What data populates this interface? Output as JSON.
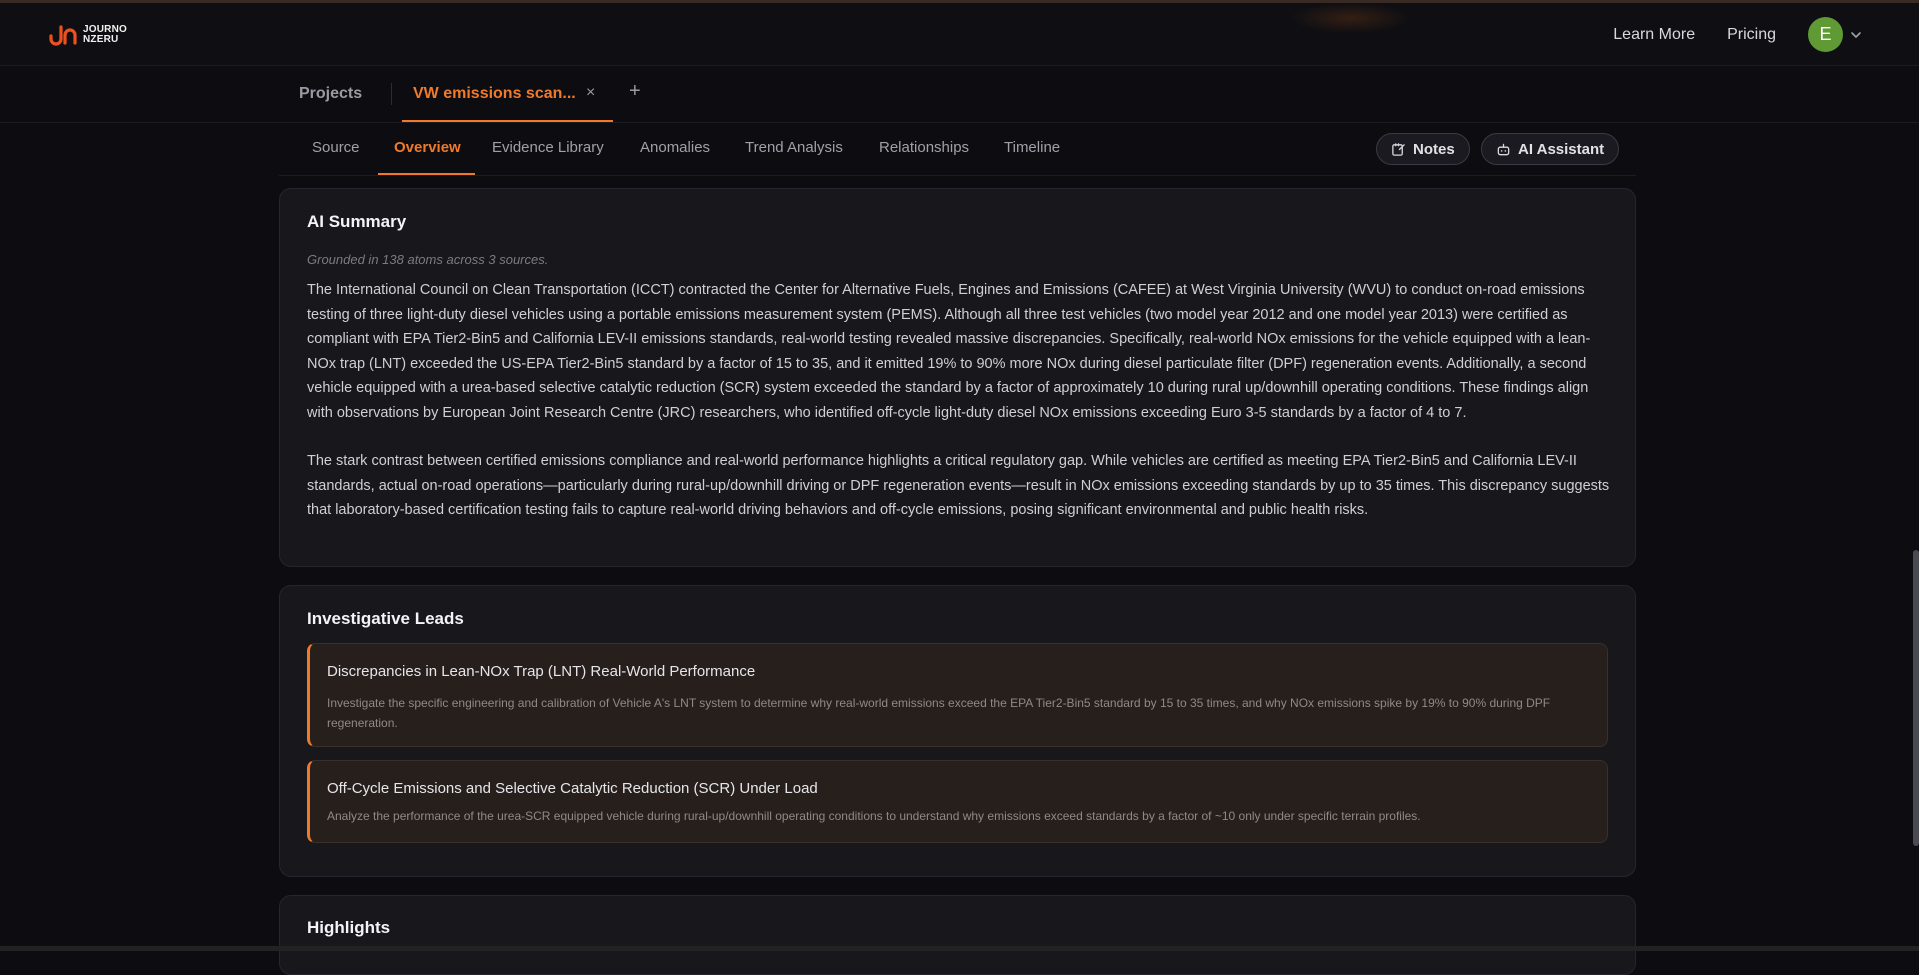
{
  "brand": {
    "line1": "JOURNO",
    "line2": "NZERU",
    "accent": "#f07a2a"
  },
  "nav": {
    "learn_more": "Learn More",
    "pricing": "Pricing",
    "avatar_initial": "E",
    "avatar_color": "#5f9a35"
  },
  "projects": {
    "projects_label": "Projects",
    "active_tab": "VW emissions scan...",
    "close_glyph": "×",
    "add_glyph": "+"
  },
  "sections": {
    "tabs": [
      "Source",
      "Overview",
      "Evidence Library",
      "Anomalies",
      "Trend Analysis",
      "Relationships",
      "Timeline"
    ],
    "active": "Overview",
    "notes": "Notes",
    "ai_assistant": "AI Assistant"
  },
  "summary": {
    "title": "AI Summary",
    "grounded": "Grounded in 138 atoms across 3 sources.",
    "paragraphs": [
      "The International Council on Clean Transportation (ICCT) contracted the Center for Alternative Fuels, Engines and Emissions (CAFEE) at West Virginia University (WVU) to conduct on-road emissions testing of three light-duty diesel vehicles using a portable emissions measurement system (PEMS). Although all three test vehicles (two model year 2012 and one model year 2013) were certified as compliant with EPA Tier2-Bin5 and California LEV-II emissions standards, real-world testing revealed massive discrepancies. Specifically, real-world NOx emissions for the vehicle equipped with a lean-NOx trap (LNT) exceeded the US-EPA Tier2-Bin5 standard by a factor of 15 to 35, and it emitted 19% to 90% more NOx during diesel particulate filter (DPF) regeneration events. Additionally, a second vehicle equipped with a urea-based selective catalytic reduction (SCR) system exceeded the standard by a factor of approximately 10 during rural up/downhill operating conditions. These findings align with observations by European Joint Research Centre (JRC) researchers, who identified off-cycle light-duty diesel NOx emissions exceeding Euro 3-5 standards by a factor of 4 to 7.",
      "The stark contrast between certified emissions compliance and real-world performance highlights a critical regulatory gap. While vehicles are certified as meeting EPA Tier2-Bin5 and California LEV-II standards, actual on-road operations—particularly during rural-up/downhill driving or DPF regeneration events—result in NOx emissions exceeding standards by up to 35 times. This discrepancy suggests that laboratory-based certification testing fails to capture real-world driving behaviors and off-cycle emissions, posing significant environmental and public health risks."
    ]
  },
  "leads": {
    "title": "Investigative Leads",
    "items": [
      {
        "title": "Discrepancies in Lean-NOx Trap (LNT) Real-World Performance",
        "description": "Investigate the specific engineering and calibration of Vehicle A's LNT system to determine why real-world emissions exceed the EPA Tier2-Bin5 standard by 15 to 35 times, and why NOx emissions spike by 19% to 90% during DPF regeneration."
      },
      {
        "title": "Off-Cycle Emissions and Selective Catalytic Reduction (SCR) Under Load",
        "description": "Analyze the performance of the urea-SCR equipped vehicle during rural-up/downhill operating conditions to understand why emissions exceed standards by a factor of ~10 only under specific terrain profiles."
      }
    ]
  },
  "highlights": {
    "title": "Highlights"
  }
}
